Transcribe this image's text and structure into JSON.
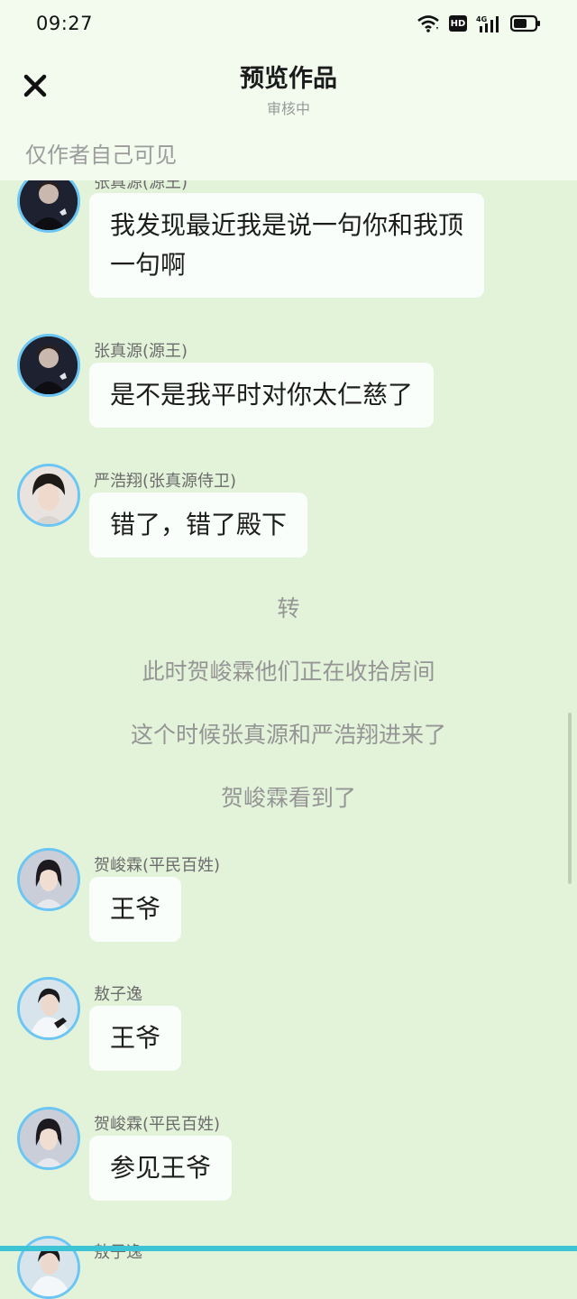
{
  "status_bar": {
    "time": "09:27",
    "hd_label": "HD",
    "network_label": "4G"
  },
  "header": {
    "title": "预览作品",
    "subtitle": "审核中",
    "visibility_note": "仅作者自己可见"
  },
  "messages": [
    {
      "name": "张真源(源王)",
      "text": "我发现最近我是说一句你和我顶一句啊",
      "avatar_icon": "avatar-zhang-icon"
    },
    {
      "name": "张真源(源王)",
      "text": "是不是我平时对你太仁慈了",
      "avatar_icon": "avatar-zhang-icon"
    },
    {
      "name": "严浩翔(张真源侍卫)",
      "text": "错了，错了殿下",
      "avatar_icon": "avatar-yan-icon"
    },
    {
      "name": "贺峻霖(平民百姓)",
      "text": "王爷",
      "avatar_icon": "avatar-he-icon"
    },
    {
      "name": "敖子逸",
      "text": "王爷",
      "avatar_icon": "avatar-ao-icon"
    },
    {
      "name": "贺峻霖(平民百姓)",
      "text": "参见王爷",
      "avatar_icon": "avatar-he-icon"
    },
    {
      "name": "敖子逸",
      "text": "",
      "avatar_icon": "avatar-ao-icon"
    }
  ],
  "narration": [
    "转",
    "此时贺峻霖他们正在收拾房间",
    "这个时候张真源和严浩翔进来了",
    "贺峻霖看到了"
  ],
  "colors": {
    "background": "#e3f3da",
    "header_bg": "#f3fbee",
    "avatar_ring": "#6cc6f4",
    "bubble": "#fafefa",
    "bottom_bar": "#3cc3d4"
  }
}
